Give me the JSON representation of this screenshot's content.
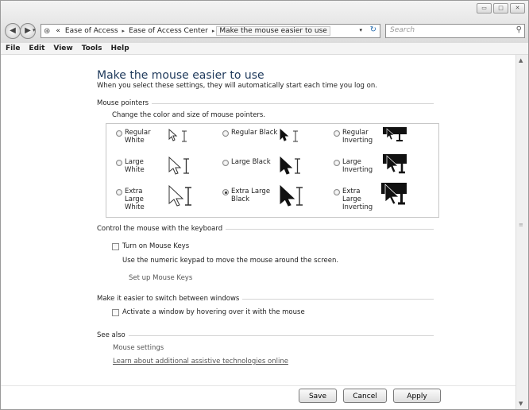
{
  "window": {
    "controls": [
      "minimize",
      "maximize",
      "close"
    ],
    "minimize_glyph": "▭",
    "maximize_glyph": "□",
    "close_glyph": "✕"
  },
  "nav": {
    "back_glyph": "◀",
    "forward_glyph": "▶",
    "dropdown_glyph": "▾"
  },
  "address": {
    "prefix": "«",
    "crumbs": [
      "Ease of Access",
      "Ease of Access Center",
      "Make the mouse easier to use"
    ],
    "sep": "▸",
    "dropdown_glyph": "▾",
    "refresh_glyph": "↻"
  },
  "search": {
    "placeholder": "Search",
    "icon": "search-icon"
  },
  "menu": [
    "File",
    "Edit",
    "View",
    "Tools",
    "Help"
  ],
  "page": {
    "title": "Make the mouse easier to use",
    "description": "When you select these settings, they will automatically start each time you log on."
  },
  "mouse_pointers": {
    "heading": "Mouse pointers",
    "instruction": "Change the color and size of mouse pointers.",
    "options": [
      {
        "label": "Regular White",
        "selected": false
      },
      {
        "label": "Regular Black",
        "selected": false
      },
      {
        "label": "Regular Inverting",
        "selected": false
      },
      {
        "label": "Large White",
        "selected": false
      },
      {
        "label": "Large Black",
        "selected": false
      },
      {
        "label": "Large Inverting",
        "selected": false
      },
      {
        "label": "Extra Large White",
        "selected": false
      },
      {
        "label": "Extra Large Black",
        "selected": true
      },
      {
        "label": "Extra Large Inverting",
        "selected": false
      }
    ]
  },
  "keyboard": {
    "heading": "Control the mouse with the keyboard",
    "checkbox_label": "Turn on Mouse Keys",
    "checked": false,
    "description": "Use the numeric keypad to move the mouse around the screen.",
    "setup_link": "Set up Mouse Keys"
  },
  "windows": {
    "heading": "Make it easier to switch between windows",
    "checkbox_label": "Activate a window by hovering over it with the mouse",
    "checked": false
  },
  "see_also": {
    "heading": "See also",
    "links": [
      "Mouse settings",
      "Learn about additional assistive technologies online"
    ]
  },
  "buttons": {
    "save": "Save",
    "cancel": "Cancel",
    "apply": "Apply"
  },
  "scrollbar": {
    "up_glyph": "▲",
    "down_glyph": "▼",
    "thumb_glyph": "≡"
  }
}
